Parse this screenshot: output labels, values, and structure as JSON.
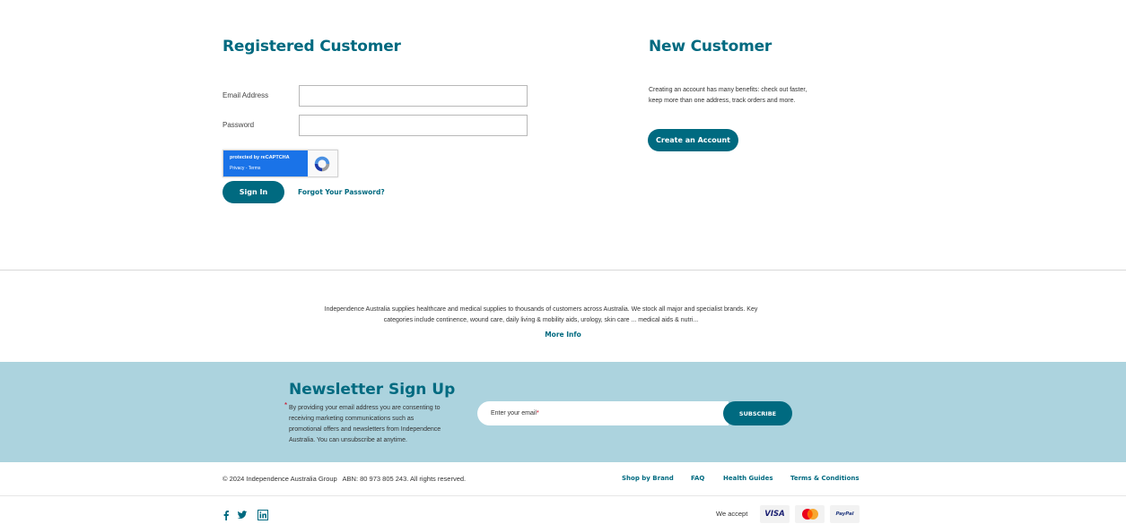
{
  "login": {
    "title": "Registered Customer",
    "email_label": "Email Address",
    "email_value": "",
    "password_label": "Password",
    "password_value": "",
    "recaptcha_line1": "protected by reCAPTCHA",
    "recaptcha_line2": "Privacy - Terms",
    "sign_in_label": "Sign In",
    "forgot_label": "Forgot Your Password?"
  },
  "register": {
    "title": "New Customer",
    "description_line1": "Creating an account has many benefits: check out faster,",
    "description_line2": "keep more than one address, track orders and more.",
    "create_label": "Create an Account"
  },
  "about": {
    "text_line1": "Independence Australia supplies healthcare and medical supplies to thousands of customers across Australia. We stock all major and specialist brands. Key",
    "text_line2": "categories include continence, wound care, daily living & mobility aids, urology, skin care ... medical aids & nutri...",
    "more_label": "More Info"
  },
  "newsletter": {
    "title": "Newsletter Sign Up",
    "consent_star": "*",
    "consent_line1": "By providing your email address you are consenting to",
    "consent_line2": "receiving marketing communications such as",
    "consent_line3": "promotional offers and newsletters from Independence",
    "consent_line4": "Australia. You can unsubscribe at anytime.",
    "email_placeholder": "Enter your email",
    "email_required": "*",
    "subscribe_label": "SUBSCRIBE"
  },
  "footer": {
    "copyright": "© 2024 Independence Australia Group   ABN: 80 973 805 243. All rights reserved.",
    "links": [
      "Shop by Brand",
      "FAQ",
      "Health Guides",
      "Terms & Conditions"
    ],
    "social_icons": [
      "facebook-icon",
      "twitter-icon",
      "linkedin-icon"
    ],
    "accept_label": "We accept",
    "payment_methods": [
      "VISA",
      "Mastercard",
      "PayPal"
    ]
  },
  "colors": {
    "accent": "#006a80",
    "newsletter_bg": "#acd3de",
    "required": "#d0021b"
  }
}
